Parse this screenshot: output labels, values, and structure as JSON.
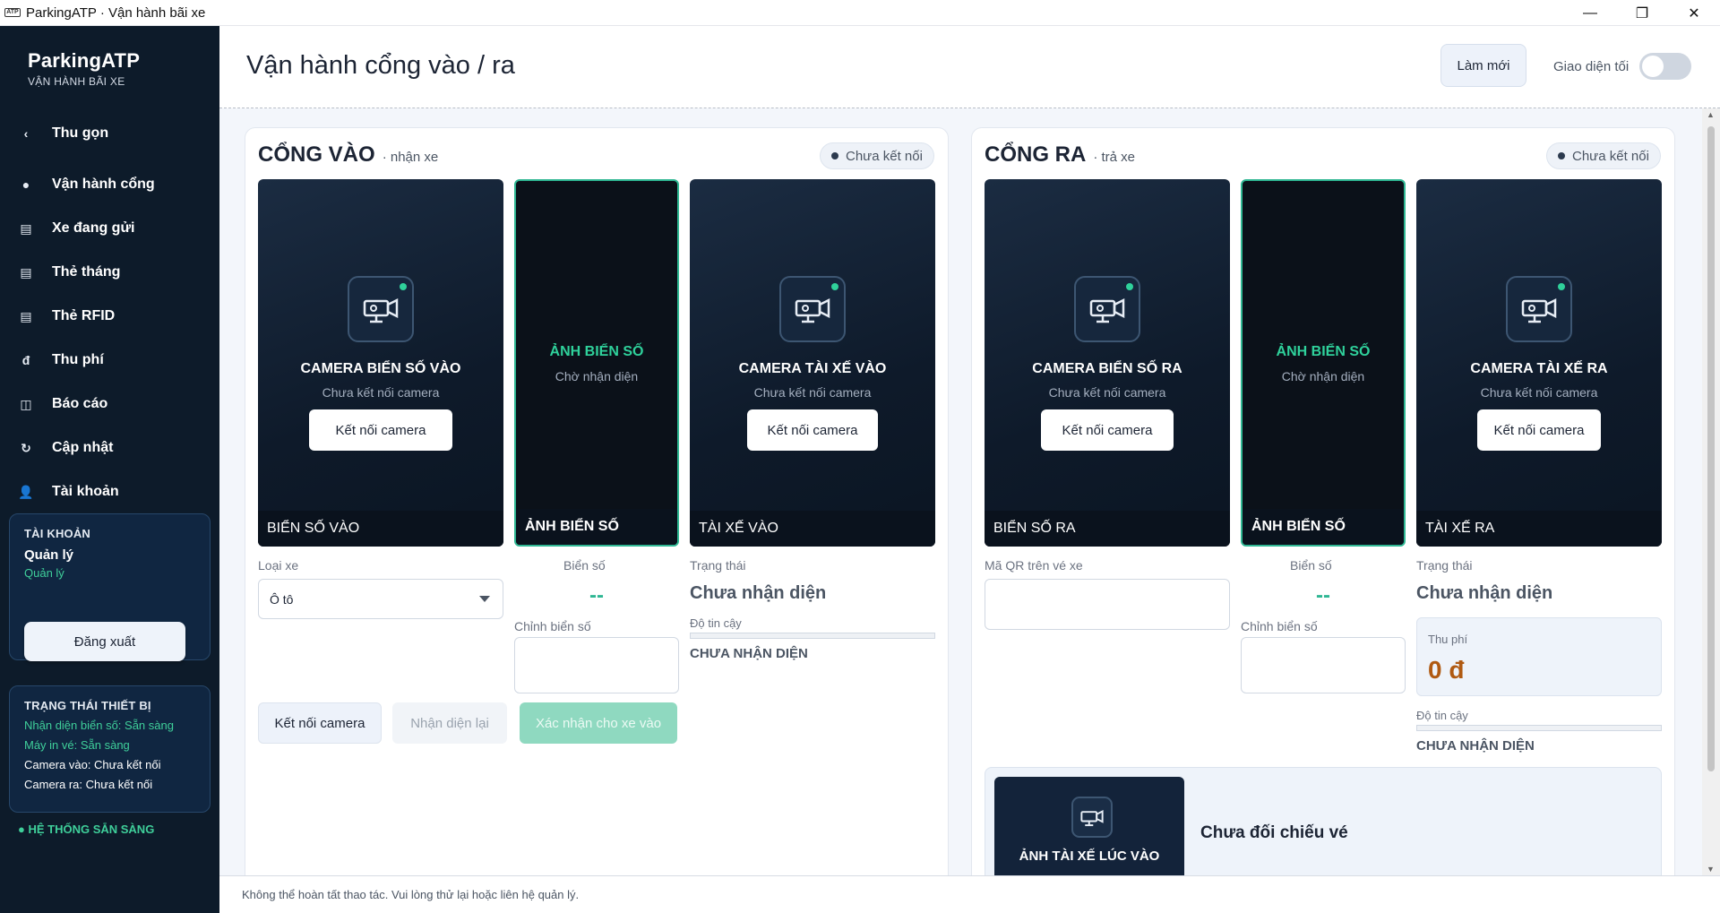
{
  "window": {
    "title": "ParkingATP · Vận hành bãi xe",
    "logo_text": "ATP"
  },
  "sidebar": {
    "brand_name": "ParkingATP",
    "brand_sub": "VẬN HÀNH BÃI XE",
    "items": [
      {
        "label": "Thu gọn",
        "icon": "‹"
      },
      {
        "label": "Vận hành cổng",
        "icon": "●"
      },
      {
        "label": "Xe đang gửi",
        "icon": "▤"
      },
      {
        "label": "Thẻ tháng",
        "icon": "▤"
      },
      {
        "label": "Thẻ RFID",
        "icon": "▤"
      },
      {
        "label": "Thu phí",
        "icon": "đ"
      },
      {
        "label": "Báo cáo",
        "icon": "◫"
      },
      {
        "label": "Cập nhật",
        "icon": "↻"
      },
      {
        "label": "Tài khoản",
        "icon": "👤"
      }
    ],
    "account": {
      "title": "TÀI KHOẢN",
      "name": "Quản lý",
      "role": "Quản lý",
      "logout_label": "Đăng xuất"
    },
    "devices": {
      "title": "TRẠNG THÁI THIẾT BỊ",
      "lines": [
        "Nhận diện biển số: Sẵn sàng",
        "Máy in vé: Sẵn sàng",
        "Camera vào: Chưa kết nối",
        "Camera ra: Chưa kết nối"
      ]
    },
    "system_status": "● HỆ THỐNG SẴN SÀNG"
  },
  "header": {
    "page_title": "Vận hành cổng vào / ra",
    "refresh_label": "Làm mới",
    "dark_mode_label": "Giao diện tối",
    "dark_mode_on": false
  },
  "gate_in": {
    "title": "CỔNG VÀO",
    "subtitle": "· nhận xe",
    "connection": "Chưa kết nối",
    "camera_plate": {
      "title": "CAMERA BIỂN SỐ VÀO",
      "status": "Chưa kết nối camera",
      "connect_label": "Kết nối camera",
      "footer": "BIỂN SỐ VÀO"
    },
    "plate_image": {
      "title": "ẢNH BIỂN SỐ",
      "status": "Chờ nhận diện",
      "footer": "ẢNH BIỂN SỐ"
    },
    "camera_driver": {
      "title": "CAMERA TÀI XẾ VÀO",
      "status": "Chưa kết nối camera",
      "connect_label": "Kết nối camera",
      "footer": "TÀI XẾ VÀO"
    },
    "vehicle_type_label": "Loại xe",
    "vehicle_type_value": "Ô tô",
    "plate_label": "Biển số",
    "plate_value": "--",
    "edit_plate_label": "Chỉnh biển số",
    "status_label": "Trạng thái",
    "status_value": "Chưa nhận diện",
    "confidence_label": "Độ tin cậy",
    "confidence_value": 0,
    "confidence_text": "CHƯA NHẬN DIỆN",
    "btn_connect": "Kết nối camera",
    "btn_recognize": "Nhận diện lại",
    "btn_confirm": "Xác nhận cho xe vào"
  },
  "gate_out": {
    "title": "CỔNG RA",
    "subtitle": "· trả xe",
    "connection": "Chưa kết nối",
    "camera_plate": {
      "title": "CAMERA BIỂN SỐ RA",
      "status": "Chưa kết nối camera",
      "connect_label": "Kết nối camera",
      "footer": "BIỂN SỐ RA"
    },
    "plate_image": {
      "title": "ẢNH BIỂN SỐ",
      "status": "Chờ nhận diện",
      "footer": "ẢNH BIỂN SỐ"
    },
    "camera_driver": {
      "title": "CAMERA TÀI XẾ RA",
      "status": "Chưa kết nối camera",
      "connect_label": "Kết nối camera",
      "footer": "TÀI XẾ RA"
    },
    "qr_label": "Mã QR trên vé xe",
    "plate_label": "Biển số",
    "plate_value": "--",
    "edit_plate_label": "Chỉnh biển số",
    "status_label": "Trạng thái",
    "status_value": "Chưa nhận diện",
    "fee_label": "Thu phí",
    "fee_value": "0 đ",
    "confidence_label": "Độ tin cậy",
    "confidence_value": 0,
    "confidence_text": "CHƯA NHẬN DIỆN",
    "compare_cam_title": "ẢNH TÀI XẾ LÚC VÀO",
    "compare_text": "Chưa đối chiếu vé"
  },
  "statusbar": {
    "message": "Không thể hoàn tất thao tác. Vui lòng thử lại hoặc liên hệ quản lý."
  },
  "colors": {
    "sidebar_bg": "#0d1b2a",
    "accent_green": "#2fb793",
    "fee_color": "#b05a12"
  }
}
